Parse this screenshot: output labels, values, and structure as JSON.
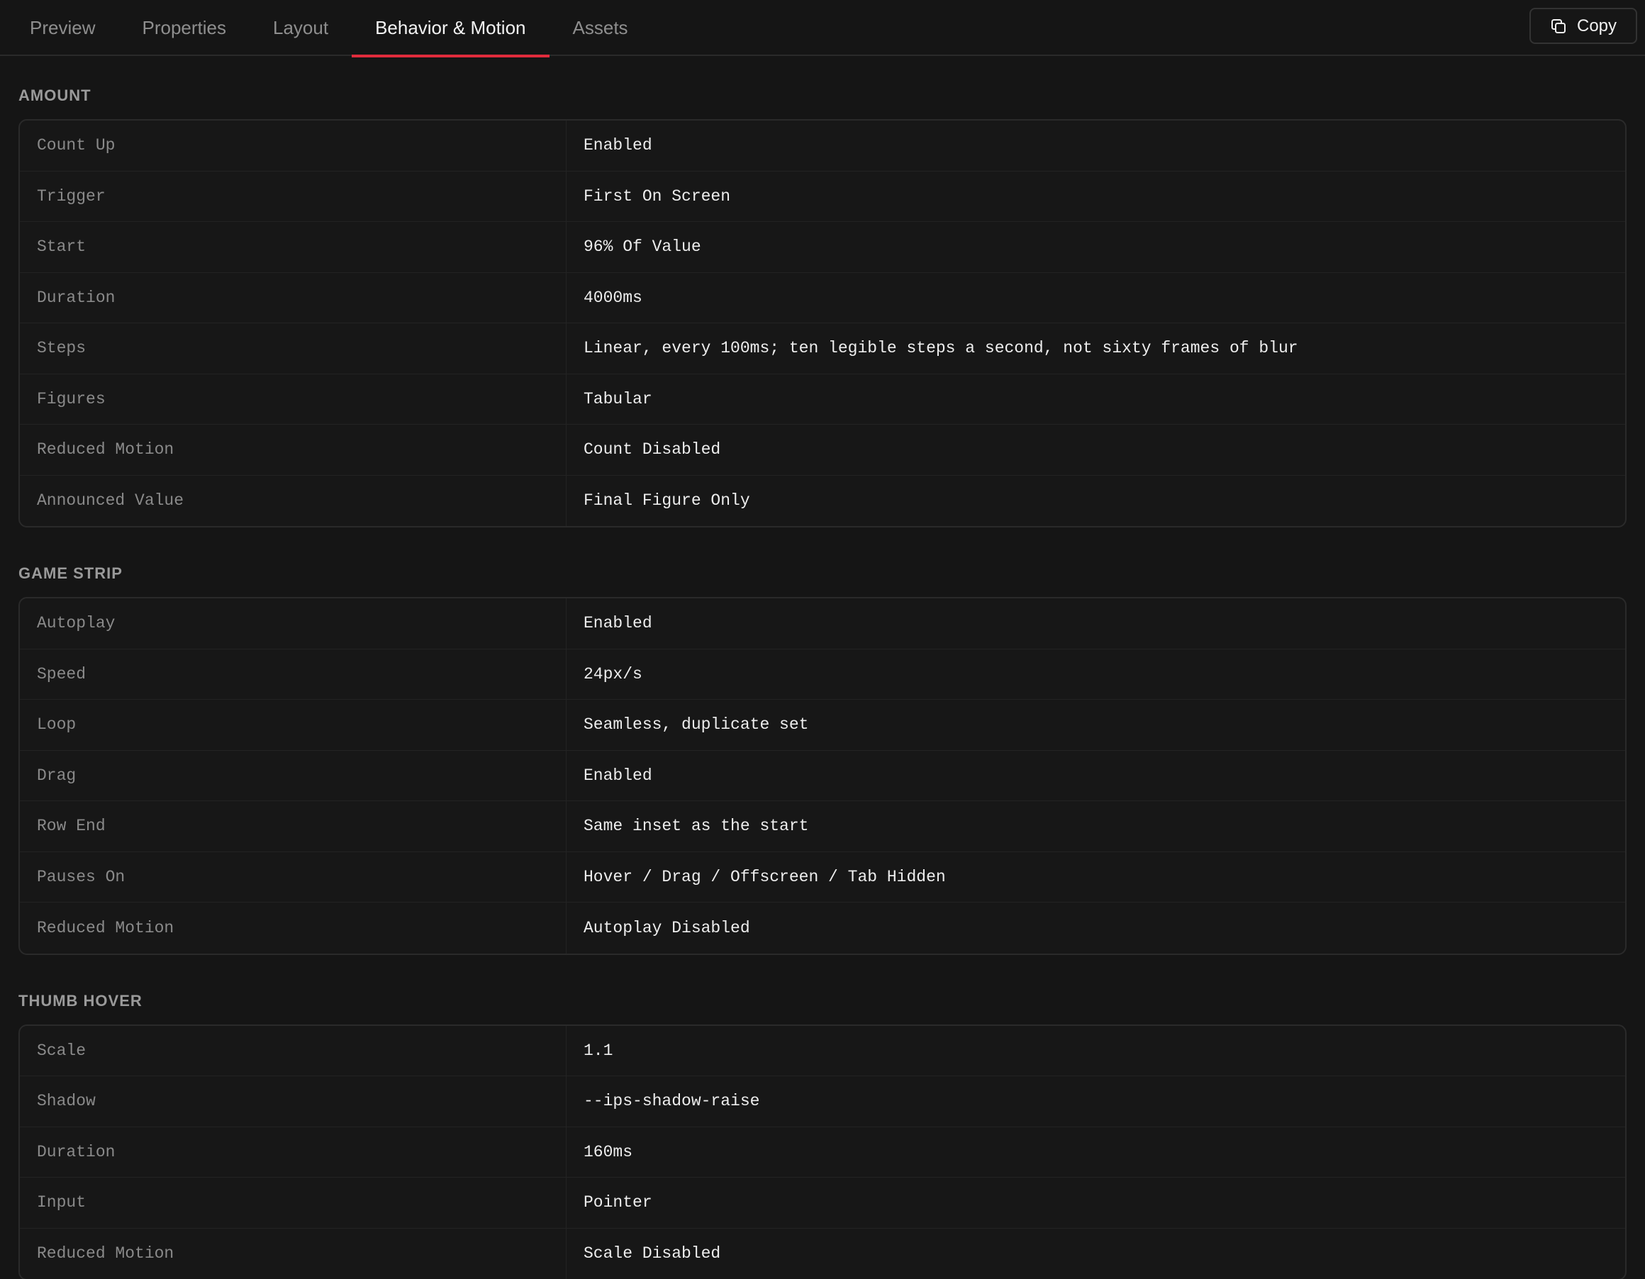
{
  "tabs": [
    {
      "label": "Preview",
      "active": false
    },
    {
      "label": "Properties",
      "active": false
    },
    {
      "label": "Layout",
      "active": false
    },
    {
      "label": "Behavior & Motion",
      "active": true
    },
    {
      "label": "Assets",
      "active": false
    }
  ],
  "copy_button": {
    "label": "Copy",
    "icon": "copy-icon"
  },
  "colors": {
    "accent": "#e02b3c",
    "background": "#151515"
  },
  "sections": [
    {
      "title": "AMOUNT",
      "rows": [
        {
          "key": "Count Up",
          "value": "Enabled"
        },
        {
          "key": "Trigger",
          "value": "First On Screen"
        },
        {
          "key": "Start",
          "value": "96% Of Value"
        },
        {
          "key": "Duration",
          "value": "4000ms"
        },
        {
          "key": "Steps",
          "value": "Linear, every 100ms; ten legible steps a second, not sixty frames of blur"
        },
        {
          "key": "Figures",
          "value": "Tabular"
        },
        {
          "key": "Reduced Motion",
          "value": "Count Disabled"
        },
        {
          "key": "Announced Value",
          "value": "Final Figure Only"
        }
      ]
    },
    {
      "title": "GAME STRIP",
      "rows": [
        {
          "key": "Autoplay",
          "value": "Enabled"
        },
        {
          "key": "Speed",
          "value": "24px/s"
        },
        {
          "key": "Loop",
          "value": "Seamless, duplicate set"
        },
        {
          "key": "Drag",
          "value": "Enabled"
        },
        {
          "key": "Row End",
          "value": "Same inset as the start"
        },
        {
          "key": "Pauses On",
          "value": "Hover / Drag / Offscreen / Tab Hidden"
        },
        {
          "key": "Reduced Motion",
          "value": "Autoplay Disabled"
        }
      ]
    },
    {
      "title": "THUMB HOVER",
      "rows": [
        {
          "key": "Scale",
          "value": "1.1"
        },
        {
          "key": "Shadow",
          "value": "--ips-shadow-raise"
        },
        {
          "key": "Duration",
          "value": "160ms"
        },
        {
          "key": "Input",
          "value": "Pointer"
        },
        {
          "key": "Reduced Motion",
          "value": "Scale Disabled"
        }
      ]
    }
  ]
}
